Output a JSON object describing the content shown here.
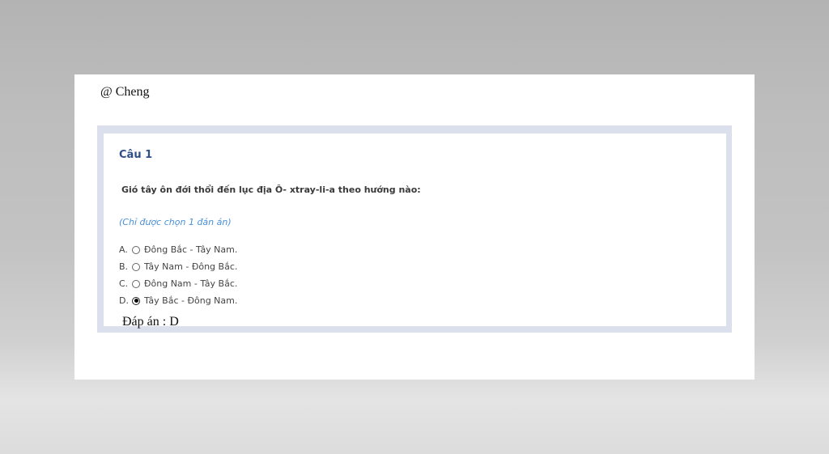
{
  "author": "@ Cheng",
  "question": {
    "title": "Câu 1",
    "text": "Gió tây ôn đới thổi đến lục địa Ô- xtray-li-a theo hướng nào:",
    "hint": "(Chỉ được chọn 1 đán án)",
    "options": [
      {
        "letter": "A.",
        "label": "Đông Bắc - Tây Nam.",
        "selected": false
      },
      {
        "letter": "B.",
        "label": "Tây Nam - Đông Bắc.",
        "selected": false
      },
      {
        "letter": "C.",
        "label": "Đông Nam - Tây Bắc.",
        "selected": false
      },
      {
        "letter": "D.",
        "label": "Tây Bắc - Đông Nam.",
        "selected": true
      }
    ]
  },
  "answer": "Đáp án : D",
  "colors": {
    "title": "#2f4f86",
    "hint": "#4a90d9",
    "frame": "#dcdfec"
  }
}
